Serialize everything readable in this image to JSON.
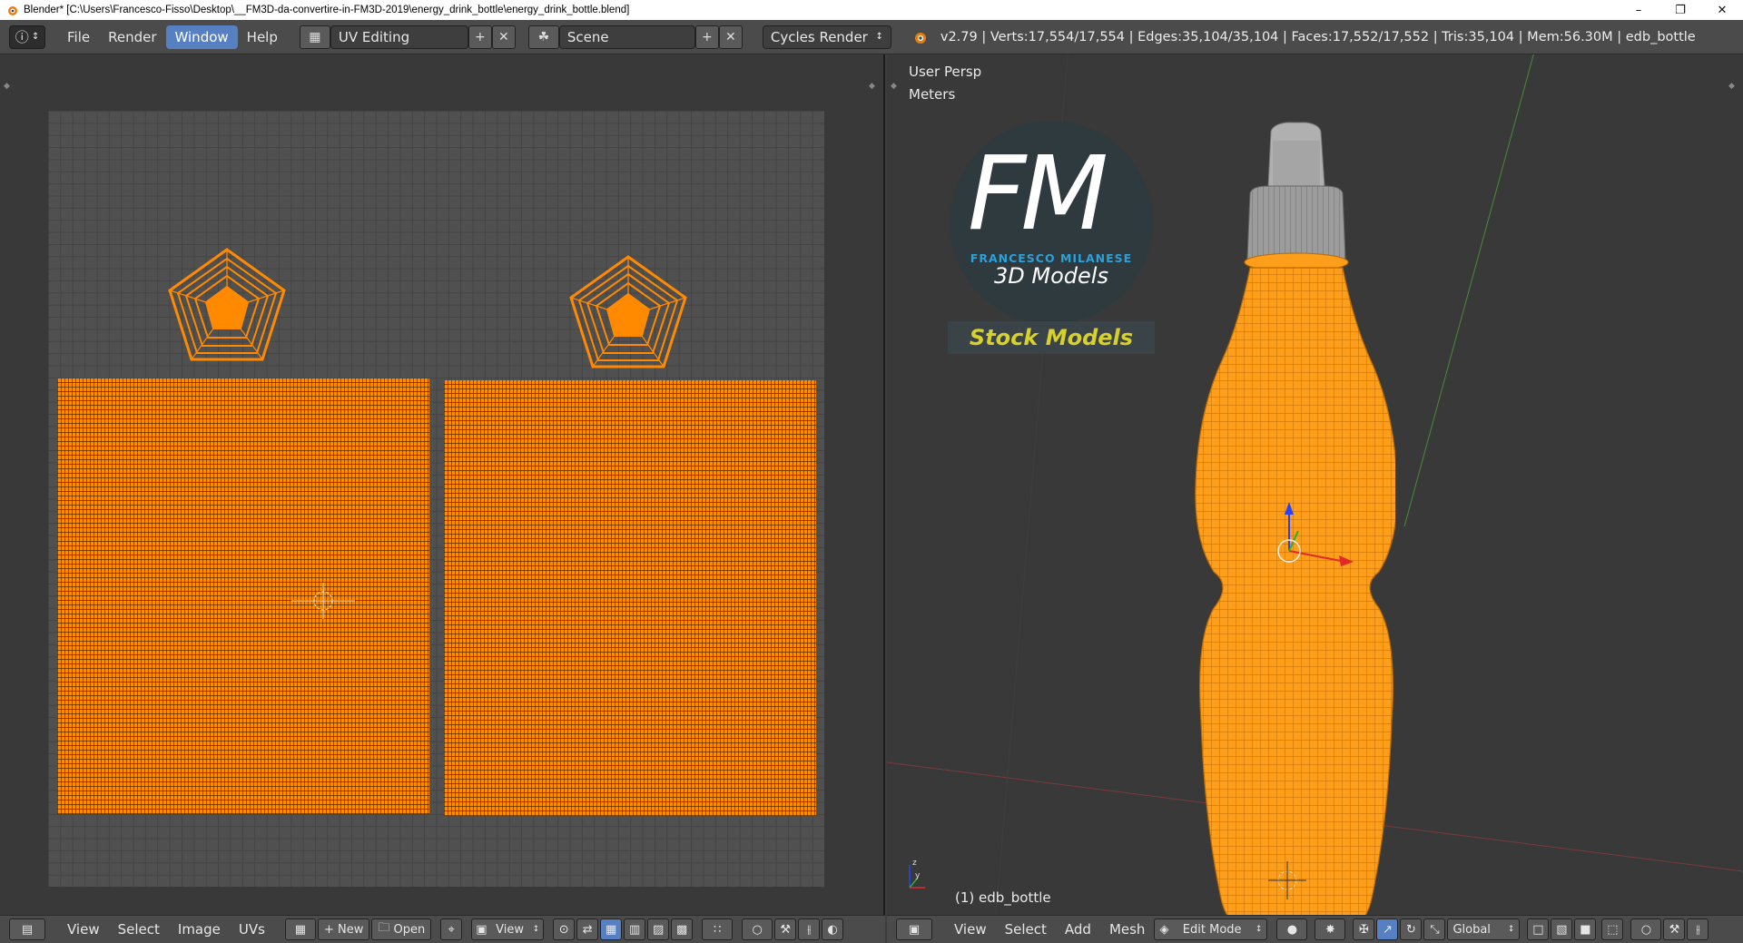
{
  "window": {
    "title": "Blender* [C:\\Users\\Francesco-Fisso\\Desktop\\__FM3D-da-convertire-in-FM3D-2019\\energy_drink_bottle\\energy_drink_bottle.blend]",
    "minimize_icon": "minimize-icon",
    "maximize_icon": "restore-icon",
    "close_icon": "close-icon"
  },
  "topbar": {
    "menus": [
      "File",
      "Render",
      "Window",
      "Help"
    ],
    "active_menu": "Window",
    "screen_layout": "UV Editing",
    "scene": "Scene",
    "render_engine": "Cycles Render",
    "stats": "v2.79 | Verts:17,554/17,554 | Edges:35,104/35,104 | Faces:17,552/17,552 | Tris:35,104 | Mem:56.30M | edb_bottle"
  },
  "viewport": {
    "view_label": "User Persp",
    "units_label": "Meters",
    "object_label": "(1) edb_bottle",
    "logo": {
      "letters": "FM",
      "name": "FRANCESCO MILANESE",
      "subtitle": "3D Models",
      "banner": "Stock Models"
    },
    "colors": {
      "mesh_selected": "#ff9e1a",
      "cap": "#aaaaaa",
      "background": "#393939"
    }
  },
  "uv_bottom": {
    "items": [
      "View",
      "Select",
      "Image",
      "UVs"
    ],
    "new_label": "New",
    "open_label": "Open",
    "view_dropdown": "View"
  },
  "view3d_bottom": {
    "items": [
      "View",
      "Select",
      "Add",
      "Mesh"
    ],
    "mode": "Edit Mode",
    "orientation": "Global"
  }
}
